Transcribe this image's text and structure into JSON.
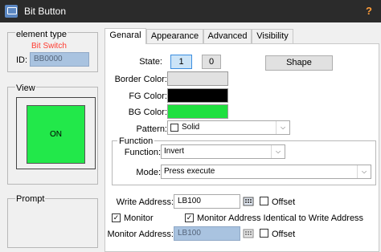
{
  "window": {
    "title": "Bit Button",
    "help_glyph": "?"
  },
  "element_type": {
    "group_title": "element type",
    "type_name": "Bit Switch",
    "id_label": "ID:",
    "id_value": "BB0000",
    "type_color": "#ff3b30"
  },
  "view": {
    "group_title": "View",
    "preview_text": "ON",
    "preview_color": "#22e84a"
  },
  "prompt": {
    "group_title": "Prompt"
  },
  "tabs": [
    {
      "label": "Genaral",
      "active": true
    },
    {
      "label": "Appearance",
      "active": false
    },
    {
      "label": "Advanced",
      "active": false
    },
    {
      "label": "Visibility",
      "active": false
    }
  ],
  "general": {
    "state_label": "State:",
    "state_on_value": "1",
    "state_off_value": "0",
    "shape_button": "Shape",
    "border_color_label": "Border Color:",
    "fg_color_label": "FG Color:",
    "bg_color_label": "BG Color:",
    "border_color": "#e1e1e1",
    "fg_color": "#000000",
    "bg_color": "#1fe03f",
    "pattern_label": "Pattern:",
    "pattern_value": "Solid",
    "function_group_title": "Function",
    "function_label": "Function:",
    "function_value": "Invert",
    "mode_label": "Mode:",
    "mode_value": "Press execute",
    "write_address_label": "Write Address:",
    "write_address_value": "LB100",
    "offset_label": "Offset",
    "monitor_label": "Monitor",
    "monitor_checked": true,
    "identical_label": "Monitor Address Identical to Write Address",
    "identical_checked": true,
    "monitor_address_label": "Monitor Address:",
    "monitor_address_value": "LB100",
    "offset2_label": "Offset"
  }
}
